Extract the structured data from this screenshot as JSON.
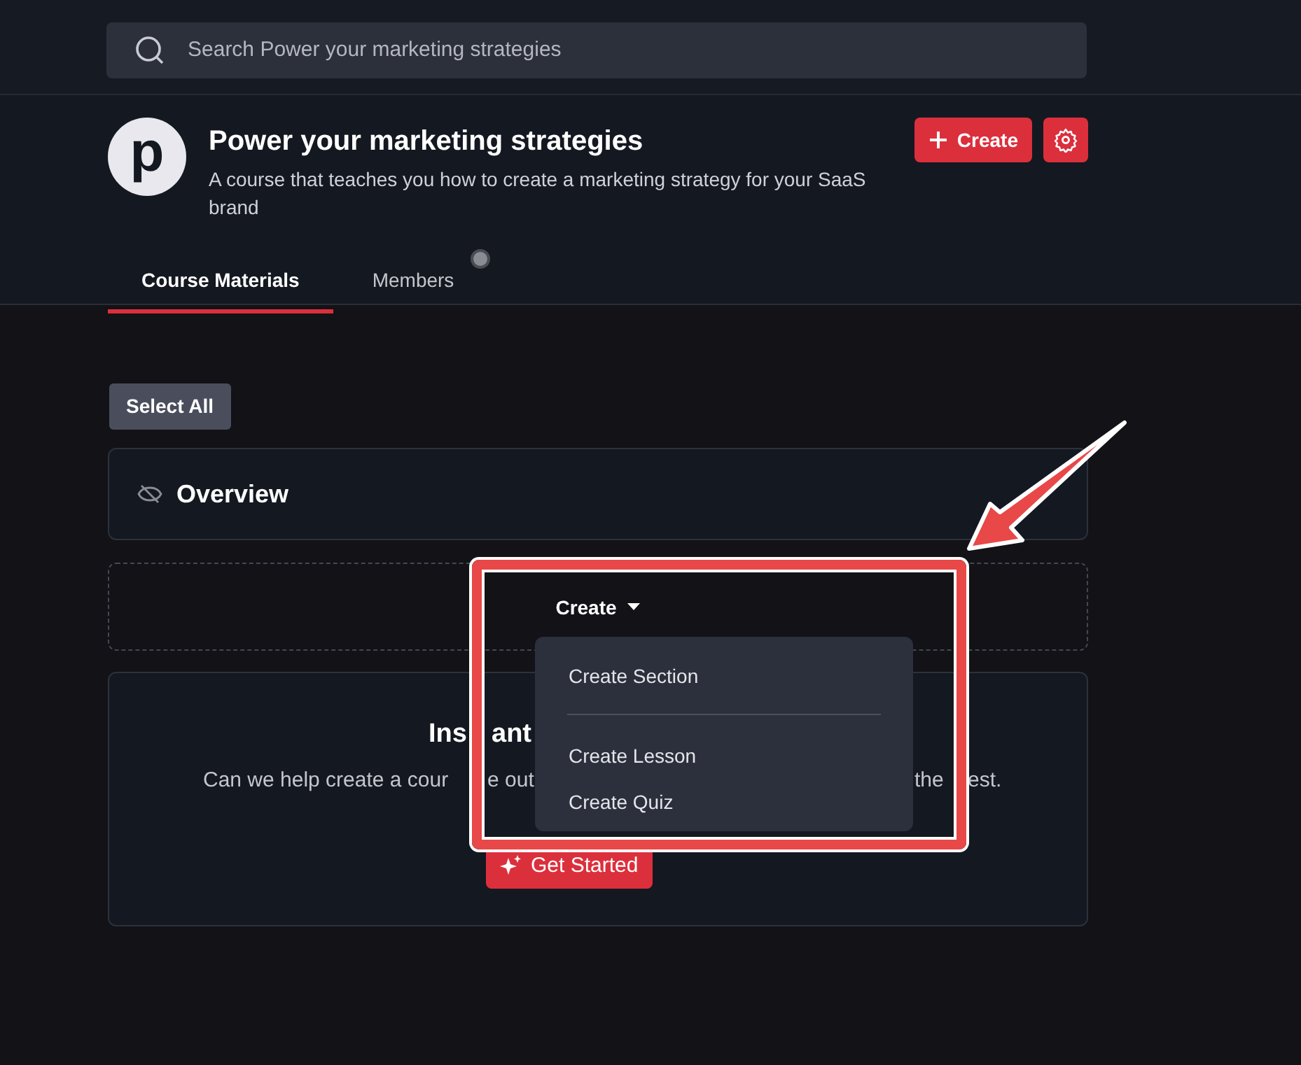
{
  "search": {
    "placeholder": "Search Power your marketing strategies"
  },
  "course": {
    "logo_letter": "p",
    "title": "Power your marketing strategies",
    "description": "A course that teaches you how to create a marketing strategy for your SaaS brand"
  },
  "header_buttons": [
    {
      "kind": "create",
      "label": "Create"
    },
    {
      "kind": "settings"
    }
  ],
  "tabs": [
    {
      "label": "Course Materials",
      "selected": true,
      "indicator": false
    },
    {
      "label": "Members",
      "selected": false,
      "indicator": true
    }
  ],
  "select_all": {
    "label": "Select All"
  },
  "sections": [
    {
      "title": "Overview",
      "visible": false
    }
  ],
  "create_dropdown": {
    "label": "Create",
    "expanded": true,
    "items": [
      {
        "kind": "item",
        "label": "Create Section"
      },
      {
        "kind": "divider"
      },
      {
        "kind": "item",
        "label": "Create Lesson"
      },
      {
        "kind": "item",
        "label": "Create Quiz"
      }
    ]
  },
  "instant_card": {
    "heading_fragments": [
      "Ins",
      "ant"
    ],
    "text_fragments": [
      "Can we help create a cour",
      "e out",
      "the",
      "est."
    ],
    "button": "Get Started"
  },
  "annotation": {
    "box": true,
    "arrow": true
  }
}
